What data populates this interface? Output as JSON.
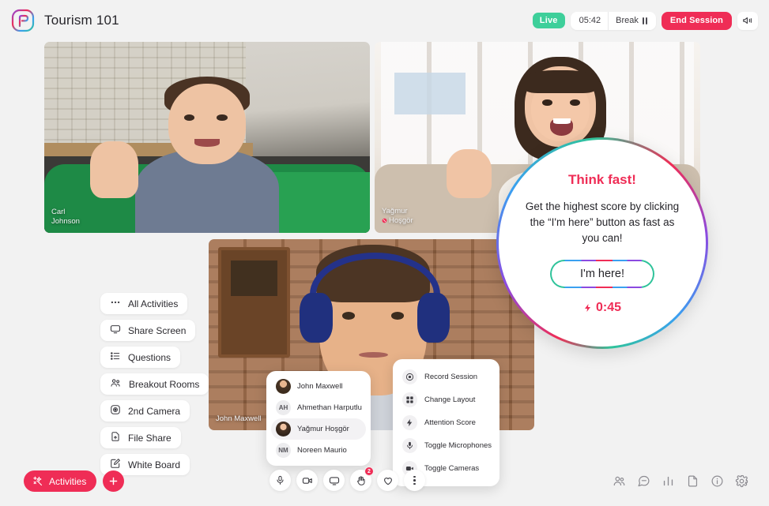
{
  "header": {
    "app_title": "Tourism 101",
    "logo_icon": "perculus-logo-icon",
    "live_label": "Live",
    "timer": "05:42",
    "break_label": "Break",
    "pause_icon": "pause-icon",
    "end_session_label": "End Session",
    "announcement_icon": "megaphone-icon"
  },
  "tiles": [
    {
      "id": "carl",
      "name": "Carl Johnson",
      "name_line1": "Carl",
      "name_line2": "Johnson",
      "muted": false
    },
    {
      "id": "yagmur",
      "name": "Yağmur Hoşgör",
      "name_line1": "Yağmur",
      "name_line2": "Hoşgör",
      "muted": true
    },
    {
      "id": "john",
      "name": "John Maxwell",
      "name_line1": "John Maxwell",
      "name_line2": "",
      "muted": false
    }
  ],
  "activity_popup": {
    "title": "Think fast!",
    "description": "Get the highest score by clicking the “I'm here” button as fast as you can!",
    "button_label": "I'm here!",
    "timer": "0:45",
    "bolt_icon": "bolt-icon"
  },
  "activities_menu": [
    {
      "label": "All Activities",
      "icon": "dots-horizontal-icon"
    },
    {
      "label": "Share Screen",
      "icon": "monitor-icon"
    },
    {
      "label": "Questions",
      "icon": "list-icon"
    },
    {
      "label": "Breakout Rooms",
      "icon": "people-icon"
    },
    {
      "label": "2nd Camera",
      "icon": "camera-lens-icon"
    },
    {
      "label": "File Share",
      "icon": "file-upload-icon"
    },
    {
      "label": "White Board",
      "icon": "whiteboard-pen-icon"
    }
  ],
  "participants_popup": [
    {
      "name": "John Maxwell",
      "initials": "",
      "avatar": "photo",
      "highlighted": false
    },
    {
      "name": "Ahmethan Harputlu",
      "initials": "AH",
      "avatar": "initials",
      "highlighted": false
    },
    {
      "name": "Yağmur Hoşgör",
      "initials": "",
      "avatar": "photo",
      "highlighted": true
    },
    {
      "name": "Noreen Maurio",
      "initials": "NM",
      "avatar": "initials",
      "highlighted": false
    }
  ],
  "context_menu": [
    {
      "label": "Record Session",
      "icon": "record-icon"
    },
    {
      "label": "Change Layout",
      "icon": "grid-layout-icon"
    },
    {
      "label": "Attention Score",
      "icon": "bolt-icon"
    },
    {
      "label": "Toggle Microphones",
      "icon": "microphone-icon"
    },
    {
      "label": "Toggle Cameras",
      "icon": "video-camera-icon"
    }
  ],
  "bottom_toolbar": [
    {
      "icon": "microphone-icon",
      "badge": ""
    },
    {
      "icon": "video-camera-icon",
      "badge": ""
    },
    {
      "icon": "monitor-icon",
      "badge": ""
    },
    {
      "icon": "raise-hand-icon",
      "badge": "2"
    },
    {
      "icon": "heart-icon",
      "badge": ""
    },
    {
      "icon": "more-vertical-icon",
      "badge": ""
    }
  ],
  "bottom_left": {
    "activities_label": "Activities",
    "activities_icon": "magic-wand-icon",
    "add_icon": "plus-icon"
  },
  "bottom_right_icons": [
    "participants-icon",
    "chat-icon",
    "analytics-icon",
    "document-icon",
    "info-icon",
    "settings-gear-icon"
  ],
  "colors": {
    "accent_pink": "#ef2d56",
    "live_green": "#3ecf9a",
    "page_bg": "#f2f2f2",
    "text_dark": "#26252a"
  }
}
